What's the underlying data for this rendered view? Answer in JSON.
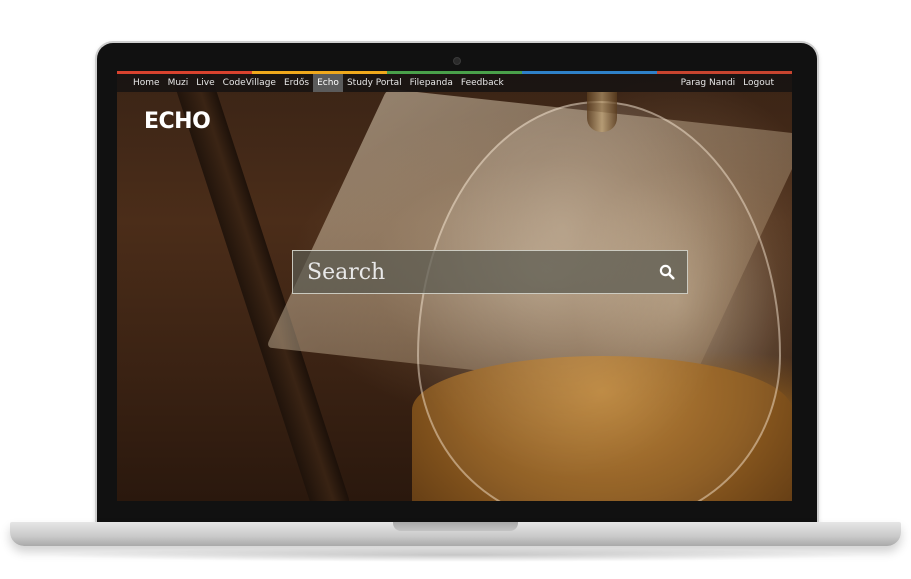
{
  "nav": {
    "left": [
      {
        "label": "Home"
      },
      {
        "label": "Muzi"
      },
      {
        "label": "Live"
      },
      {
        "label": "CodeVillage"
      },
      {
        "label": "Erdős"
      },
      {
        "label": "Echo",
        "active": true
      },
      {
        "label": "Study Portal"
      },
      {
        "label": "Filepanda"
      },
      {
        "label": "Feedback"
      }
    ],
    "right": [
      {
        "label": "Parag Nandi"
      },
      {
        "label": "Logout"
      }
    ]
  },
  "logo": "ECHO",
  "search": {
    "placeholder": "Search",
    "value": ""
  },
  "icons": {
    "search": "search-icon"
  },
  "colors": {
    "stripe": [
      "#d9422e",
      "#f0a81c",
      "#4aa04a",
      "#2f80c8",
      "#c8442f"
    ],
    "active_nav": "#5b5b5b"
  }
}
